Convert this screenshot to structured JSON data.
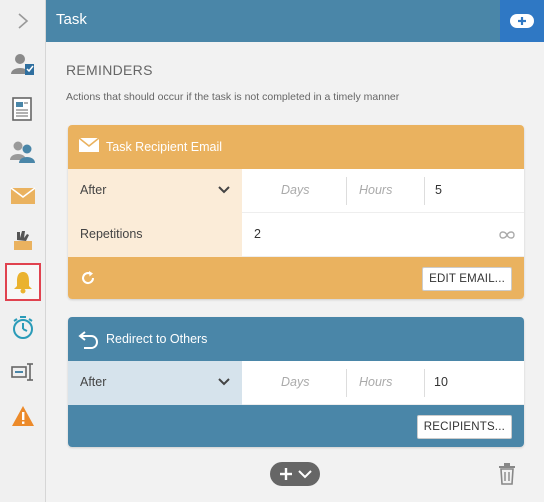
{
  "header": {
    "title": "Task"
  },
  "reminders": {
    "title": "REMINDERS",
    "description": "Actions that should occur if the task is not completed in a timely manner"
  },
  "email_card": {
    "title": "Task Recipient Email",
    "timing_select": "After",
    "days_placeholder": "Days",
    "hours_placeholder": "Hours",
    "minutes_value": "5",
    "repetitions_label": "Repetitions",
    "repetitions_value": "2",
    "edit_button": "EDIT EMAIL..."
  },
  "redirect_card": {
    "title": "Redirect to Others",
    "timing_select": "After",
    "days_placeholder": "Days",
    "hours_placeholder": "Hours",
    "minutes_value": "10",
    "recipients_button": "RECIPIENTS..."
  },
  "rail": {
    "icons": [
      "chevron-right-icon",
      "user-task-icon",
      "form-icon",
      "users-icon",
      "envelope-icon",
      "hand-icon",
      "bell-icon",
      "stopwatch-icon",
      "text-cursor-icon",
      "warning-icon"
    ],
    "active": "bell-icon"
  },
  "colors": {
    "accent_blue": "#4a86a8",
    "accent_orange": "#eab25f",
    "active_border": "#e0424f"
  }
}
